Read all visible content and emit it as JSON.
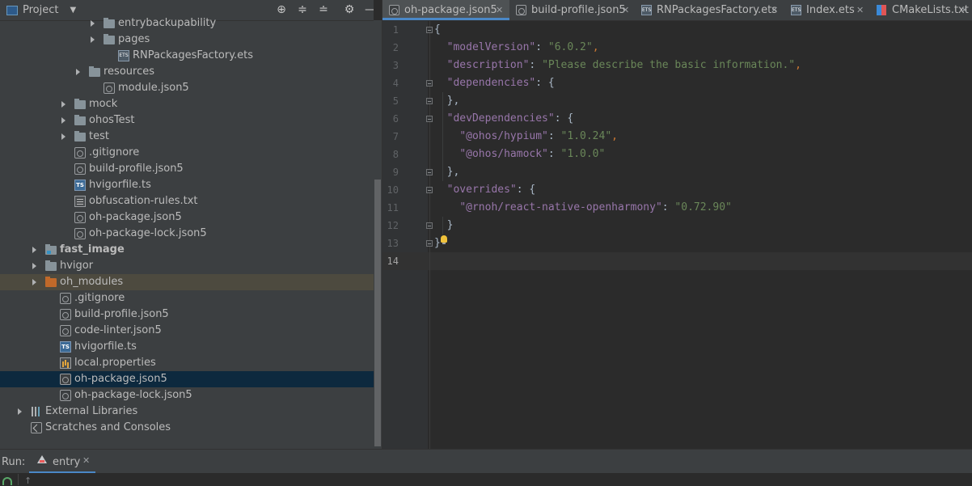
{
  "project": {
    "title": "Project",
    "tree": [
      {
        "label": "entrybackupability",
        "depth": 5,
        "icon": "folder-icon",
        "arrow": true
      },
      {
        "label": "pages",
        "depth": 5,
        "icon": "folder-icon",
        "arrow": true
      },
      {
        "label": "RNPackagesFactory.ets",
        "depth": 6,
        "icon": "ets-file-icon"
      },
      {
        "label": "resources",
        "depth": 4,
        "icon": "folder-icon",
        "arrow": true
      },
      {
        "label": "module.json5",
        "depth": 5,
        "icon": "json5-file-icon"
      },
      {
        "label": "mock",
        "depth": 3,
        "icon": "folder-icon",
        "arrow": true
      },
      {
        "label": "ohosTest",
        "depth": 3,
        "icon": "folder-icon",
        "arrow": true
      },
      {
        "label": "test",
        "depth": 3,
        "icon": "folder-icon",
        "arrow": true
      },
      {
        "label": ".gitignore",
        "depth": 3,
        "icon": "gitignore-file-icon"
      },
      {
        "label": "build-profile.json5",
        "depth": 3,
        "icon": "json5-file-icon"
      },
      {
        "label": "hvigorfile.ts",
        "depth": 3,
        "icon": "ts-file-icon"
      },
      {
        "label": "obfuscation-rules.txt",
        "depth": 3,
        "icon": "text-file-icon"
      },
      {
        "label": "oh-package.json5",
        "depth": 3,
        "icon": "json5-file-icon"
      },
      {
        "label": "oh-package-lock.json5",
        "depth": 3,
        "icon": "json5-file-icon"
      },
      {
        "label": "fast_image",
        "depth": 1,
        "icon": "module-folder-icon",
        "arrow": true,
        "bold": true
      },
      {
        "label": "hvigor",
        "depth": 1,
        "icon": "folder-icon",
        "arrow": true
      },
      {
        "label": "oh_modules",
        "depth": 1,
        "icon": "excluded-folder-icon",
        "arrow": true,
        "highlight": true
      },
      {
        "label": ".gitignore",
        "depth": 2,
        "icon": "gitignore-file-icon"
      },
      {
        "label": "build-profile.json5",
        "depth": 2,
        "icon": "json5-file-icon"
      },
      {
        "label": "code-linter.json5",
        "depth": 2,
        "icon": "json5-file-icon"
      },
      {
        "label": "hvigorfile.ts",
        "depth": 2,
        "icon": "ts-file-icon"
      },
      {
        "label": "local.properties",
        "depth": 2,
        "icon": "properties-file-icon"
      },
      {
        "label": "oh-package.json5",
        "depth": 2,
        "icon": "json5-file-icon",
        "selected": true
      },
      {
        "label": "oh-package-lock.json5",
        "depth": 2,
        "icon": "json5-file-icon"
      },
      {
        "label": "External Libraries",
        "depth": 0,
        "icon": "libraries-icon",
        "arrow": true
      },
      {
        "label": "Scratches and Consoles",
        "depth": 0,
        "icon": "scratches-icon"
      }
    ]
  },
  "editor": {
    "tabs": [
      {
        "label": "oh-package.json5",
        "icon": "json5-file-icon",
        "active": true
      },
      {
        "label": "build-profile.json5",
        "icon": "json5-file-icon"
      },
      {
        "label": "RNPackagesFactory.ets",
        "icon": "ets-file-icon"
      },
      {
        "label": "Index.ets",
        "icon": "ets-file-icon"
      },
      {
        "label": "CMakeLists.txt",
        "icon": "cmake-file-icon"
      }
    ],
    "current_line": 14,
    "lines": [
      [
        {
          "t": "{",
          "c": "punct"
        }
      ],
      [
        {
          "t": "  ",
          "c": "punct"
        },
        {
          "t": "\"modelVersion\"",
          "c": "key"
        },
        {
          "t": ": ",
          "c": "punct"
        },
        {
          "t": "\"6.0.2\"",
          "c": "str"
        },
        {
          "t": ",",
          "c": "comma"
        }
      ],
      [
        {
          "t": "  ",
          "c": "punct"
        },
        {
          "t": "\"description\"",
          "c": "key"
        },
        {
          "t": ": ",
          "c": "punct"
        },
        {
          "t": "\"Please describe the basic information.\"",
          "c": "str"
        },
        {
          "t": ",",
          "c": "comma"
        }
      ],
      [
        {
          "t": "  ",
          "c": "punct"
        },
        {
          "t": "\"dependencies\"",
          "c": "key"
        },
        {
          "t": ": {",
          "c": "punct"
        }
      ],
      [
        {
          "t": "  },",
          "c": "punct"
        }
      ],
      [
        {
          "t": "  ",
          "c": "punct"
        },
        {
          "t": "\"devDependencies\"",
          "c": "key"
        },
        {
          "t": ": {",
          "c": "punct"
        }
      ],
      [
        {
          "t": "    ",
          "c": "punct"
        },
        {
          "t": "\"@ohos/hypium\"",
          "c": "key"
        },
        {
          "t": ": ",
          "c": "punct"
        },
        {
          "t": "\"1.0.24\"",
          "c": "str"
        },
        {
          "t": ",",
          "c": "comma"
        }
      ],
      [
        {
          "t": "    ",
          "c": "punct"
        },
        {
          "t": "\"@ohos/hamock\"",
          "c": "key"
        },
        {
          "t": ": ",
          "c": "punct"
        },
        {
          "t": "\"1.0.0\"",
          "c": "str"
        }
      ],
      [
        {
          "t": "  },",
          "c": "punct"
        }
      ],
      [
        {
          "t": "  ",
          "c": "punct"
        },
        {
          "t": "\"overrides\"",
          "c": "key"
        },
        {
          "t": ": {",
          "c": "punct"
        }
      ],
      [
        {
          "t": "    ",
          "c": "punct"
        },
        {
          "t": "\"@rnoh/react-native-openharmony\"",
          "c": "key"
        },
        {
          "t": ": ",
          "c": "punct"
        },
        {
          "t": "\"0.72.90\"",
          "c": "str"
        }
      ],
      [
        {
          "t": "  }",
          "c": "punct"
        }
      ],
      [
        {
          "t": "}",
          "c": "punct"
        }
      ],
      []
    ]
  },
  "run": {
    "label": "Run:",
    "tab_label": "entry"
  },
  "colors": {
    "accent": "#4a88c7",
    "selection": "#0d293e",
    "json_key": "#9876aa",
    "json_string": "#6a8759",
    "comma": "#cc7832"
  }
}
